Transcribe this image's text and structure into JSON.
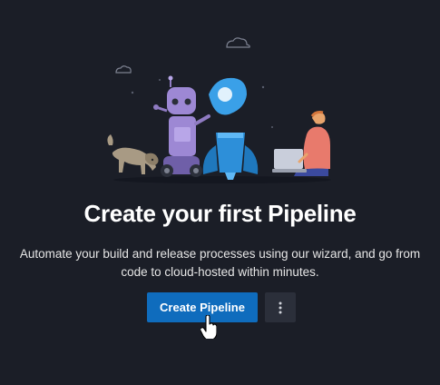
{
  "empty_state": {
    "title": "Create your first Pipeline",
    "description": "Automate your build and release processes using our wizard, and go from code to cloud-hosted within minutes.",
    "primary_button_label": "Create Pipeline",
    "more_button_icon": "more-vertical-icon"
  },
  "colors": {
    "background": "#1b1e27",
    "primary_button": "#0f6cbd",
    "secondary_button": "#2b2f3a",
    "title_text": "#ffffff",
    "body_text": "#e6e6e6"
  },
  "illustration": {
    "elements": [
      "cloud-icon",
      "robot",
      "rocket",
      "dog",
      "person-with-laptop"
    ]
  }
}
